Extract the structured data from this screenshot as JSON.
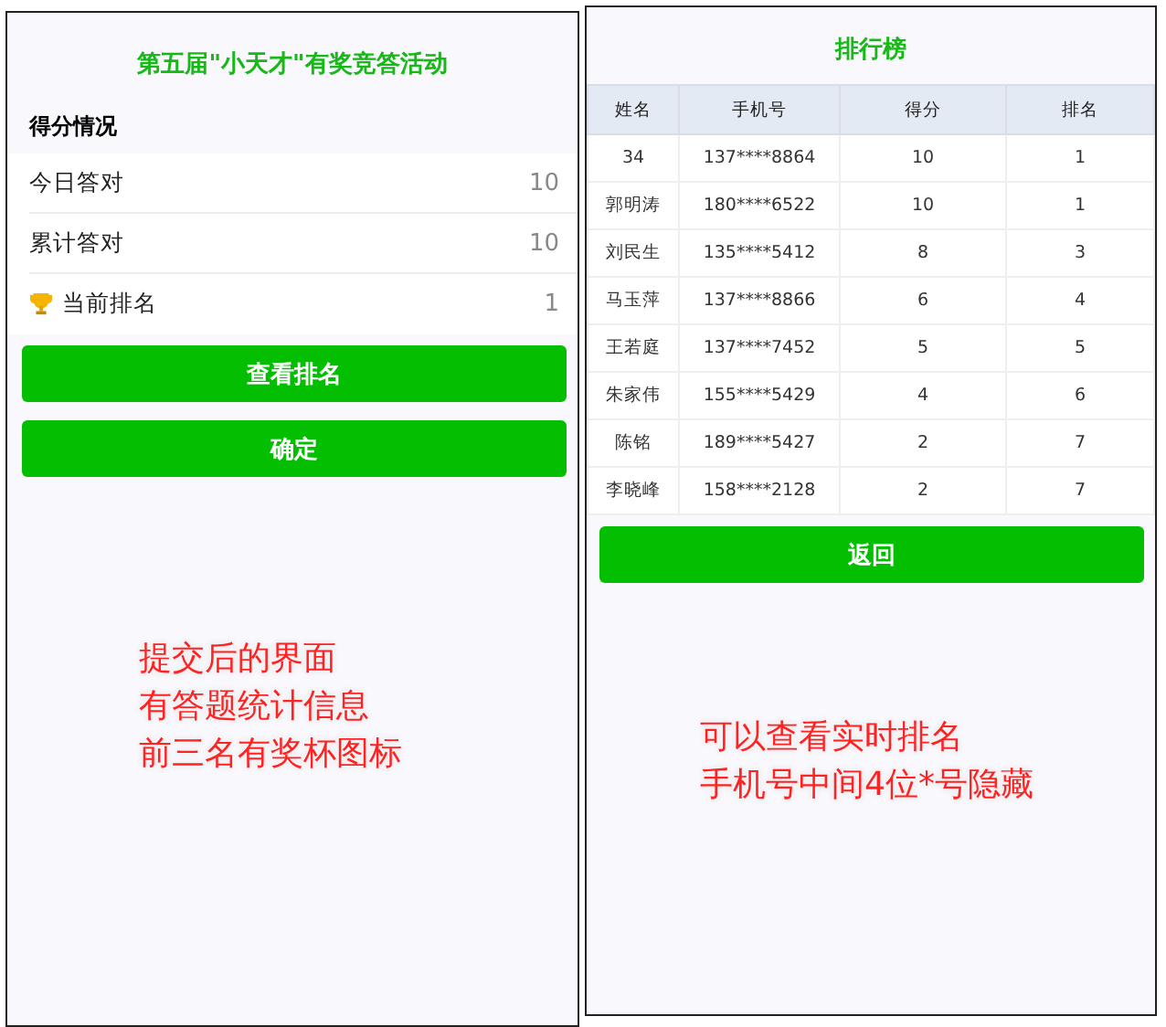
{
  "score_screen": {
    "title": "第五届\"小天才\"有奖竞答活动",
    "section_title": "得分情况",
    "stats": [
      {
        "kind": "plain",
        "label": "今日答对",
        "value": "10"
      },
      {
        "kind": "plain",
        "label": "累计答对",
        "value": "10"
      },
      {
        "kind": "trophy",
        "label": "当前排名",
        "value": "1"
      }
    ],
    "buttons": [
      "查看排名",
      "确定"
    ],
    "annotation": [
      "提交后的界面",
      "有答题统计信息",
      "前三名有奖杯图标"
    ]
  },
  "ranking_screen": {
    "title": "排行榜",
    "columns": [
      "姓名",
      "手机号",
      "得分",
      "排名"
    ],
    "rows": [
      [
        "34",
        "137****8864",
        "10",
        "1"
      ],
      [
        "郭明涛",
        "180****6522",
        "10",
        "1"
      ],
      [
        "刘民生",
        "135****5412",
        "8",
        "3"
      ],
      [
        "马玉萍",
        "137****8866",
        "6",
        "4"
      ],
      [
        "王若庭",
        "137****7452",
        "5",
        "5"
      ],
      [
        "朱家伟",
        "155****5429",
        "4",
        "6"
      ],
      [
        "陈铭",
        "189****5427",
        "2",
        "7"
      ],
      [
        "李晓峰",
        "158****2128",
        "2",
        "7"
      ]
    ],
    "button": "返回",
    "annotation": [
      "可以查看实时排名",
      "手机号中间4位*号隐藏"
    ]
  }
}
